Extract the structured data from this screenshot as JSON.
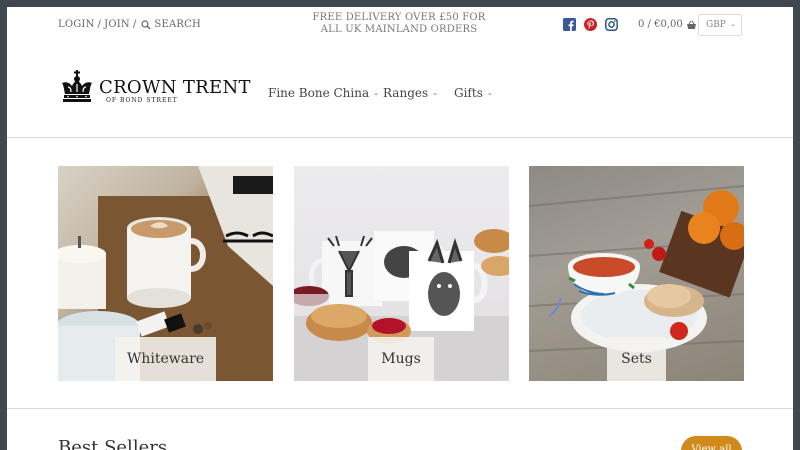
{
  "topbar": {
    "login": "LOGIN",
    "join": "JOIN",
    "search": "SEARCH",
    "promo_line1": "FREE DELIVERY OVER £50 FOR",
    "promo_line2": "ALL UK MAINLAND ORDERS",
    "cart": "0 / €0,00",
    "currency": "GBP"
  },
  "icons": [
    "search-icon",
    "facebook-icon",
    "pinterest-icon",
    "instagram-icon",
    "basket-icon",
    "crown-logo-icon",
    "chevron-down-icon"
  ],
  "colors": {
    "facebook": "#3b5998",
    "pinterest": "#cb2027",
    "instagram": "#2a5a85",
    "accent": "#d08a1c"
  },
  "logo": {
    "name": "CROWN TRENT",
    "sub": "OF BOND STREET"
  },
  "nav": [
    {
      "label": "Fine Bone China"
    },
    {
      "label": "Ranges"
    },
    {
      "label": "Gifts"
    }
  ],
  "tiles": [
    {
      "label": "Whiteware"
    },
    {
      "label": "Mugs"
    },
    {
      "label": "Sets"
    }
  ],
  "section": {
    "title": "Best Sellers",
    "view_all": "View all"
  }
}
